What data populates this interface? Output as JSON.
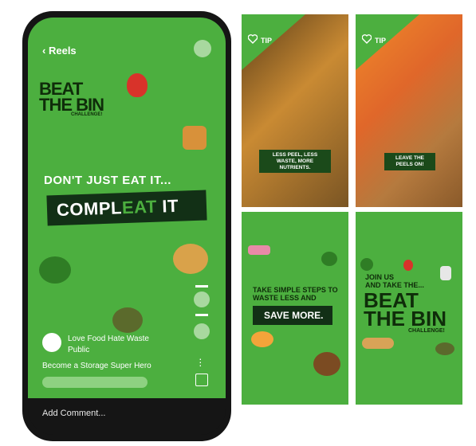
{
  "phone": {
    "back_label": "Reels",
    "logo": {
      "line1": "BEAT",
      "line2": "THE BIN",
      "line3": "CHALLENGE!"
    },
    "headline": "DON'T JUST EAT IT...",
    "comp_prefix": "COMPL",
    "comp_mid": "EAT",
    "comp_suffix": " IT",
    "account_name": "Love Food Hate Waste",
    "account_privacy": "Public",
    "caption": "Become a Storage Super Hero",
    "comment_placeholder": "Add Comment..."
  },
  "cards": [
    {
      "tip": "TIP",
      "label": "LESS PEEL, LESS WASTE, MORE NUTRIENTS."
    },
    {
      "tip": "TIP",
      "label": "LEAVE THE PEELS ON!"
    },
    {
      "text1": "TAKE SIMPLE STEPS TO",
      "text2": "WASTE LESS AND",
      "save": "SAVE MORE."
    },
    {
      "text1": "JOIN US",
      "text2": "AND TAKE THE...",
      "logo1": "BEAT",
      "logo2": "THE BIN",
      "logo3": "CHALLENGE!"
    }
  ],
  "colors": {
    "accent": "#4caf3f",
    "dark": "#123016"
  }
}
